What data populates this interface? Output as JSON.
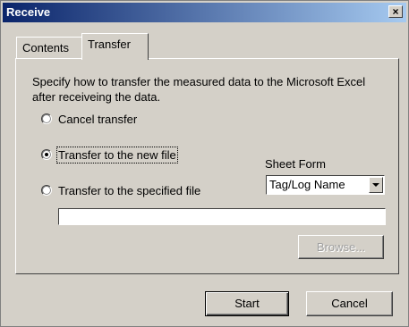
{
  "window": {
    "title": "Receive",
    "close_label": "×"
  },
  "tabs": [
    {
      "label": "Contents"
    },
    {
      "label": "Transfer"
    }
  ],
  "transfer": {
    "description": "Specify how to transfer the measured data to the Microsoft Excel after receiveing the data.",
    "options": [
      {
        "label": "Cancel transfer",
        "checked": false
      },
      {
        "label": "Transfer to the new file",
        "checked": true
      },
      {
        "label": "Transfer to the specified file",
        "checked": false
      }
    ],
    "sheet_form_label": "Sheet Form",
    "sheet_form_value": "Tag/Log Name",
    "file_path_value": "",
    "browse_label": "Browse..."
  },
  "footer": {
    "start_label": "Start",
    "cancel_label": "Cancel"
  }
}
